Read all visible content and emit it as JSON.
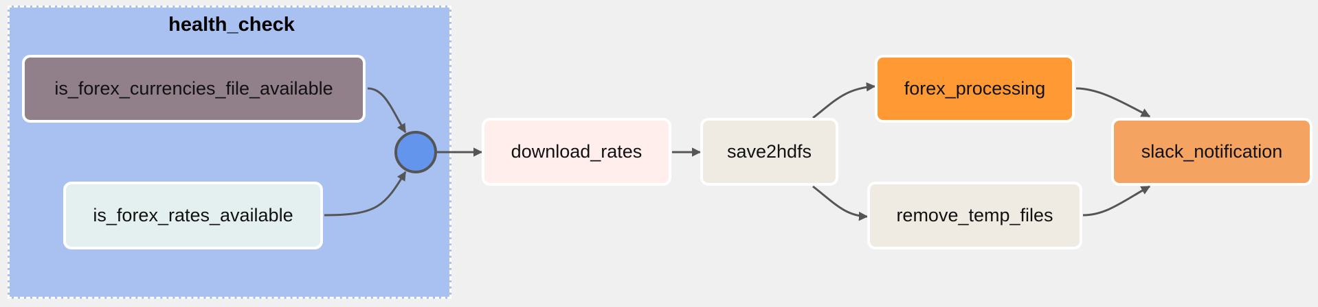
{
  "group": {
    "title": "health_check",
    "color": "#a9c1f0"
  },
  "nodes": [
    {
      "id": "is_forex_currencies_file_available",
      "label": "is_forex_currencies_file_available",
      "color": "#917f89"
    },
    {
      "id": "is_forex_rates_available",
      "label": "is_forex_rates_available",
      "color": "#e3f0ef"
    },
    {
      "id": "download_rates",
      "label": "download_rates",
      "color": "#ffeeeb"
    },
    {
      "id": "save2hdfs",
      "label": "save2hdfs",
      "color": "#efebe3"
    },
    {
      "id": "forex_processing",
      "label": "forex_processing",
      "color": "#ff9933"
    },
    {
      "id": "remove_temp_files",
      "label": "remove_temp_files",
      "color": "#efebe3"
    },
    {
      "id": "slack_notification",
      "label": "slack_notification",
      "color": "#f4a460"
    }
  ],
  "join_node_color": "#6495ed",
  "edges": [
    [
      "is_forex_currencies_file_available",
      "join"
    ],
    [
      "is_forex_rates_available",
      "join"
    ],
    [
      "join",
      "download_rates"
    ],
    [
      "download_rates",
      "save2hdfs"
    ],
    [
      "save2hdfs",
      "forex_processing"
    ],
    [
      "save2hdfs",
      "remove_temp_files"
    ],
    [
      "forex_processing",
      "slack_notification"
    ],
    [
      "remove_temp_files",
      "slack_notification"
    ]
  ]
}
